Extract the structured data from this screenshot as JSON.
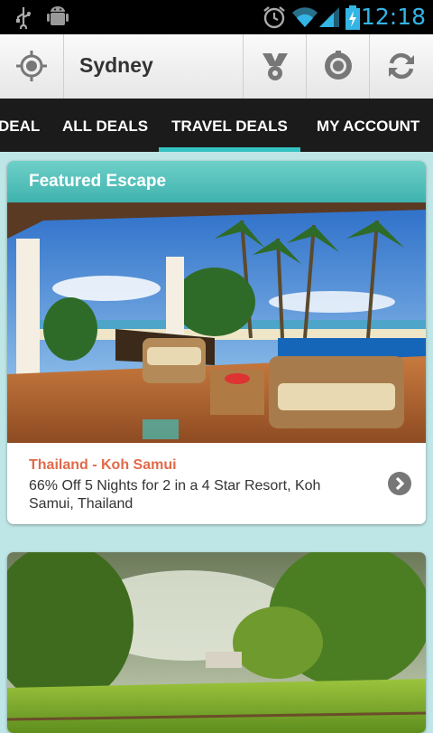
{
  "status_bar": {
    "time": "12:18"
  },
  "action_bar": {
    "city": "Sydney"
  },
  "tabs": [
    {
      "label": "DEAL"
    },
    {
      "label": "ALL DEALS"
    },
    {
      "label": "TRAVEL DEALS"
    },
    {
      "label": "MY ACCOUNT"
    }
  ],
  "active_tab": "TRAVEL DEALS",
  "featured": {
    "header": "Featured Escape",
    "destination": "Thailand - Koh Samui",
    "description": "66% Off 5 Nights for 2 in a 4 Star Resort, Koh Samui, Thailand"
  },
  "colors": {
    "accent": "#35c2c2",
    "destination": "#e26a4a",
    "clock": "#33b5e5"
  }
}
